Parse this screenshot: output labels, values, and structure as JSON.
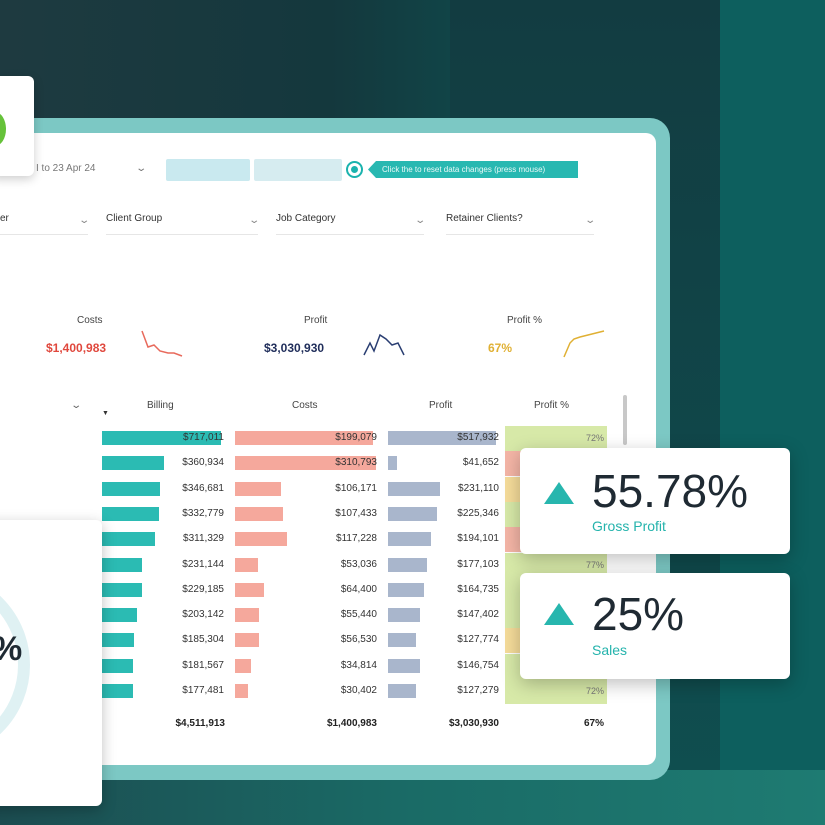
{
  "colors": {
    "teal": "#2bbbb3",
    "salmon": "#f5a89c",
    "slate": "#a9b6cc",
    "green_cell": "#d7e9a8",
    "red_text": "#e0483d",
    "navy_text": "#1f2d5a",
    "gold_text": "#e0b033"
  },
  "toolbar": {
    "date_range": "I to 23 Apr 24",
    "info_text": "Click the to reset data changes (press mouse)"
  },
  "filters": [
    {
      "label": "er"
    },
    {
      "label": "Client Group"
    },
    {
      "label": "Job Category"
    },
    {
      "label": "Retainer Clients?"
    }
  ],
  "kpis": {
    "costs": {
      "label": "Costs",
      "value": "$1,400,983"
    },
    "profit": {
      "label": "Profit",
      "value": "$3,030,930"
    },
    "profit_pct": {
      "label": "Profit %",
      "value": "67%"
    }
  },
  "table": {
    "headers": {
      "billing": "Billing",
      "costs": "Costs",
      "profit": "Profit",
      "profit_pct": "Profit %"
    },
    "rows": [
      {
        "billing": "$717,011",
        "billing_frac": 0.96,
        "costs": "$199,079",
        "costs_frac": 0.96,
        "profit": "$517,932",
        "profit_frac": 0.96,
        "pct": "72%",
        "pct_color": "#d7e9a8"
      },
      {
        "billing": "$360,934",
        "billing_frac": 0.5,
        "costs": "$310,793",
        "costs_frac": 0.98,
        "profit": "$41,652",
        "profit_frac": 0.08,
        "pct": "",
        "pct_color": "#f4b5a6"
      },
      {
        "billing": "$346,681",
        "billing_frac": 0.47,
        "costs": "$106,171",
        "costs_frac": 0.32,
        "profit": "$231,110",
        "profit_frac": 0.46,
        "pct": "",
        "pct_color": "#f5dc9a"
      },
      {
        "billing": "$332,779",
        "billing_frac": 0.46,
        "costs": "$107,433",
        "costs_frac": 0.33,
        "profit": "$225,346",
        "profit_frac": 0.44,
        "pct": "",
        "pct_color": "#d7e9a8"
      },
      {
        "billing": "$311,329",
        "billing_frac": 0.43,
        "costs": "$117,228",
        "costs_frac": 0.36,
        "profit": "$194,101",
        "profit_frac": 0.38,
        "pct": "",
        "pct_color": "#f4b5a6"
      },
      {
        "billing": "$231,144",
        "billing_frac": 0.32,
        "costs": "$53,036",
        "costs_frac": 0.16,
        "profit": "$177,103",
        "profit_frac": 0.35,
        "pct": "77%",
        "pct_color": "#d7e9a8"
      },
      {
        "billing": "$229,185",
        "billing_frac": 0.32,
        "costs": "$64,400",
        "costs_frac": 0.2,
        "profit": "$164,735",
        "profit_frac": 0.32,
        "pct": "",
        "pct_color": "#d7e9a8"
      },
      {
        "billing": "$203,142",
        "billing_frac": 0.28,
        "costs": "$55,440",
        "costs_frac": 0.17,
        "profit": "$147,402",
        "profit_frac": 0.29,
        "pct": "",
        "pct_color": "#d7e9a8"
      },
      {
        "billing": "$185,304",
        "billing_frac": 0.26,
        "costs": "$56,530",
        "costs_frac": 0.17,
        "profit": "$127,774",
        "profit_frac": 0.25,
        "pct": "",
        "pct_color": "#f5dc9a"
      },
      {
        "billing": "$181,567",
        "billing_frac": 0.25,
        "costs": "$34,814",
        "costs_frac": 0.11,
        "profit": "$146,754",
        "profit_frac": 0.29,
        "pct": "",
        "pct_color": "#d7e9a8"
      },
      {
        "billing": "$177,481",
        "billing_frac": 0.25,
        "costs": "$30,402",
        "costs_frac": 0.09,
        "profit": "$127,279",
        "profit_frac": 0.25,
        "pct": "72%",
        "pct_color": "#d7e9a8"
      }
    ],
    "totals": {
      "billing": "$4,511,913",
      "costs": "$1,400,983",
      "profit": "$3,030,930",
      "profit_pct": "67%"
    }
  },
  "gauge": {
    "value": "%"
  },
  "stats": [
    {
      "value": "55.78%",
      "label": "Gross Profit",
      "trend": "up-arrow-icon"
    },
    {
      "value": "25%",
      "label": "Sales",
      "trend": "up-arrow-icon"
    }
  ]
}
